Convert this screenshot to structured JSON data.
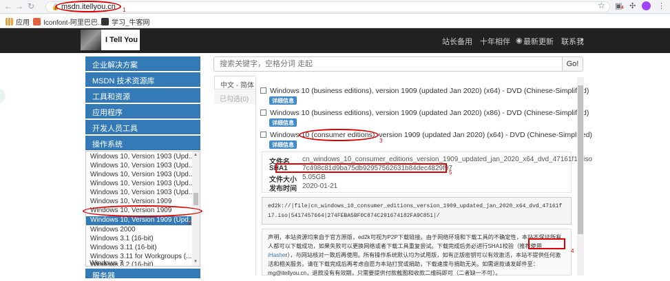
{
  "browser": {
    "url": "msdn.itellyou.cn",
    "badge_count": "4"
  },
  "bookmarks": [
    {
      "label": "应用",
      "color": "#e8a33d"
    },
    {
      "label": "Iconfont-阿里巴巴...",
      "color": "#e4603c"
    },
    {
      "label": "学习_牛客网",
      "color": "#333333"
    }
  ],
  "site": {
    "logo_text": "I Tell You",
    "nav": [
      "站长备用",
      "十年相伴",
      "最新更新",
      "联系我"
    ]
  },
  "sidebar": {
    "menu": [
      "企业解决方案",
      "MSDN 技术资源库",
      "工具和资源",
      "应用程序",
      "开发人员工具",
      "操作系统",
      "服务器"
    ],
    "os_list": [
      "Windows 10, Version 1903 (Upd...",
      "Windows 10, Version 1903 (Upd...",
      "Windows 10, Version 1903 (Upd...",
      "Windows 10, Version 1903 (Upd...",
      "Windows 10, Version 1903 (Upd...",
      "Windows 10, Version 1909",
      "Windows 10, Version 1909",
      "Windows 10, Version 1909 (Upd...",
      "Windows 2000",
      "Windows 3.1 (16-bit)",
      "Windows 3.11 (16-bit)",
      "Windows 3.11 for Workgroups (...",
      "Windows 3.2 (16-bit)",
      "Windows 7"
    ],
    "selected_index": 7
  },
  "search": {
    "placeholder": "搜索关键字，空格分词 走起",
    "button": "Go!"
  },
  "tabs": [
    "中文 - 简体",
    "已勾选(0)"
  ],
  "items": [
    {
      "title": "Windows 10 (business editions), version 1909 (updated Jan 2020) (x64) - DVD (Chinese-Simplified)",
      "detail": "详细信息"
    },
    {
      "title": "Windows 10 (business editions), version 1909 (updated Jan 2020) (x86) - DVD (Chinese-Simplified)",
      "detail": "详细信息"
    },
    {
      "title": "Windows 10 (consumer editions), version 1909 (updated Jan 2020) (x64) - DVD (Chinese-Simplified)",
      "detail": "详细信息"
    }
  ],
  "detail": {
    "filename_label": "文件名",
    "filename": "cn_windows_10_consumer_editions_version_1909_updated_jan_2020_x64_dvd_47161f17.iso",
    "sha1_label": "SHA1",
    "sha1": "7c498c81d9ba75db92957562631b84dec4829f97",
    "size_label": "文件大小",
    "size": "5.05GB",
    "date_label": "发布时间",
    "date": "2020-01-21"
  },
  "ed2k": "ed2k://|file|cn_windows_10_consumer_editions_version_1909_updated_jan_2020_x64_dvd_47161f17.iso|5417457664|274FEBA5BF0C874C291674182FA9C851|/",
  "notice": {
    "text": "声明，本站资源均来自于官方原版，ed2k可视为P2P下载链接。由于网络环境和下载工具的不确定性，本站不保证所有人都可以下载成功，如果失败可以更换网络或者下载工具重复尝试。下载完成后务必进行SHA1校验（推荐使用",
    "link": "iHashe",
    "text2": "r），与网站核对一致后再使用。所有操作系统默认均为试用版，如有正版密钥可以有效激活，本站不提供任何激活和相关服务。请在下载完成后再考虑自愿为本站打赏或捐助，下载速度与捐助无关。如需退款请发邮件至：mg@itellyou.cn，退款没有有效期，只需要提供付款截图和收款二维码即可（二者缺一不可）。"
  },
  "annotations": [
    "1",
    "2",
    "3",
    "4",
    "5"
  ]
}
